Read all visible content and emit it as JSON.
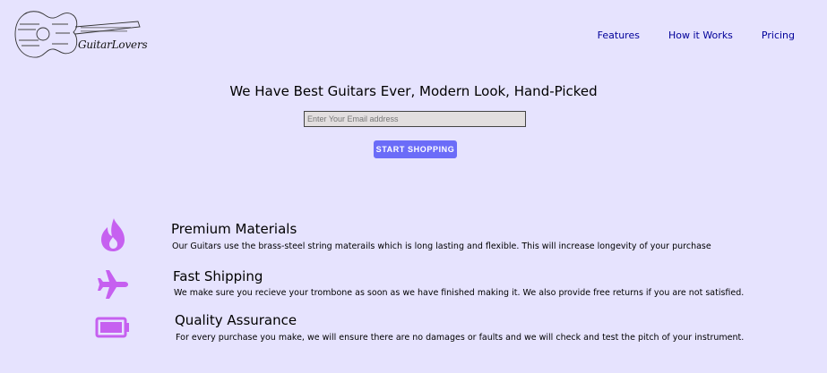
{
  "header": {
    "logo_text": "GuitarLovers",
    "nav": [
      {
        "label": "Features"
      },
      {
        "label": "How it Works"
      },
      {
        "label": "Pricing"
      }
    ]
  },
  "hero": {
    "title": "We Have Best Guitars Ever, Modern Look, Hand-Picked",
    "email_placeholder": "Enter Your Email address",
    "email_value": "",
    "cta_label": "START SHOPPING"
  },
  "features": [
    {
      "icon": "flame-icon",
      "title": "Premium Materials",
      "description": "Our Guitars use the brass-steel string materails which is long lasting and flexible. This will increase longevity of your purchase"
    },
    {
      "icon": "airplane-icon",
      "title": "Fast Shipping",
      "description": "We make sure you recieve your trombone as soon as we have finished making it. We also provide free returns if you are not satisfied."
    },
    {
      "icon": "battery-icon",
      "title": "Quality Assurance",
      "description": "For every purchase you make, we will ensure there are no damages or faults and we will check and test the pitch of your instrument."
    }
  ],
  "colors": {
    "background": "#e6e3fe",
    "nav_link": "#000099",
    "button": "#6b6cf8",
    "icon": "#c660f0"
  }
}
